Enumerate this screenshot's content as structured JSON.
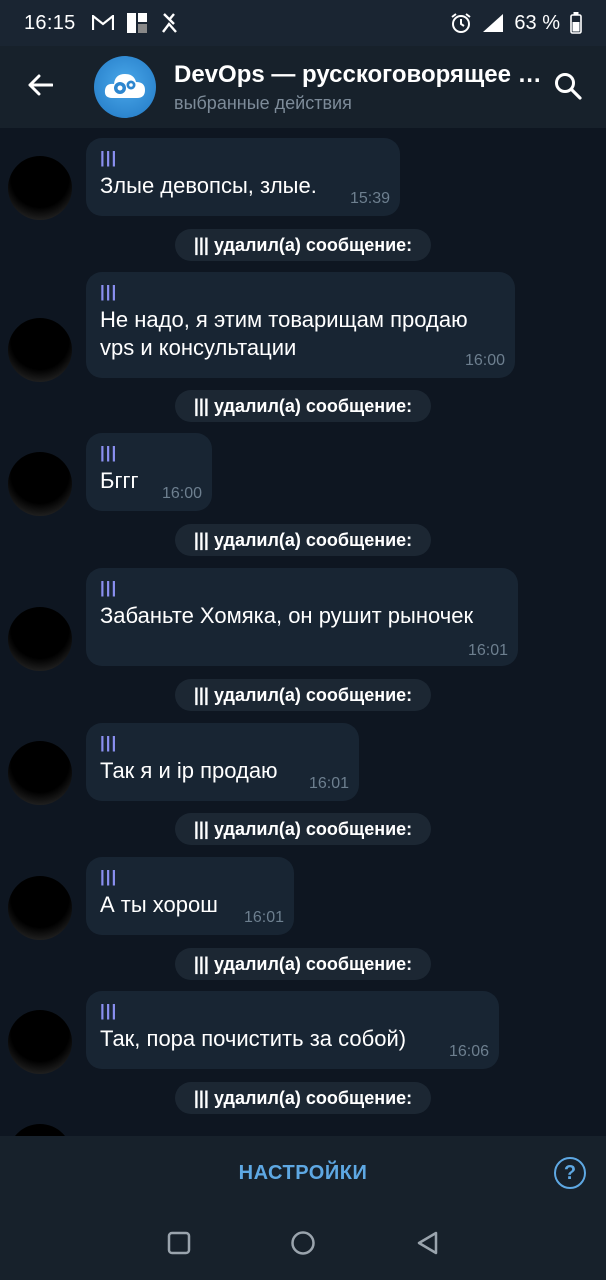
{
  "status_bar": {
    "time": "16:15",
    "battery": "63 %",
    "icons_left": [
      "gmail-icon",
      "app-icon",
      "vpn-icon"
    ],
    "icons_right": [
      "alarm-icon",
      "signal-icon",
      "battery-icon"
    ]
  },
  "header": {
    "title": "DevOps — русскоговорящее сообщество",
    "subtitle": "выбранные действия"
  },
  "messages": [
    {
      "author": "|||",
      "text": "Злые девопсы, злые.",
      "time": "15:39"
    },
    {
      "author": "|||",
      "text": "Не надо, я этим товарищам продаю vps и консультации",
      "time": "16:00"
    },
    {
      "author": "|||",
      "text": "Бггг",
      "time": "16:00"
    },
    {
      "author": "|||",
      "text": "Забаньте Хомяка, он рушит рыночек",
      "time": "16:01"
    },
    {
      "author": "|||",
      "text": "Так я и ip продаю",
      "time": "16:01"
    },
    {
      "author": "|||",
      "text": "А ты хорош",
      "time": "16:01"
    },
    {
      "author": "|||",
      "text": "Так, пора почистить за собой)",
      "time": "16:06"
    }
  ],
  "service_messages": [
    "||| удалил(а) сообщение:",
    "||| удалил(а) сообщение:",
    "||| удалил(а) сообщение:",
    "||| удалил(а) сообщение:",
    "||| удалил(а) сообщение:",
    "||| удалил(а) сообщение:",
    "||| удалил(а) сообщение:"
  ],
  "bottom_bar": {
    "settings_label": "НАСТРОЙКИ",
    "help_label": "?"
  },
  "colors": {
    "background": "#0e1621",
    "header": "#17212b",
    "bubble": "#182533",
    "accent": "#5ea8e3",
    "author": "#8a8ff0"
  }
}
